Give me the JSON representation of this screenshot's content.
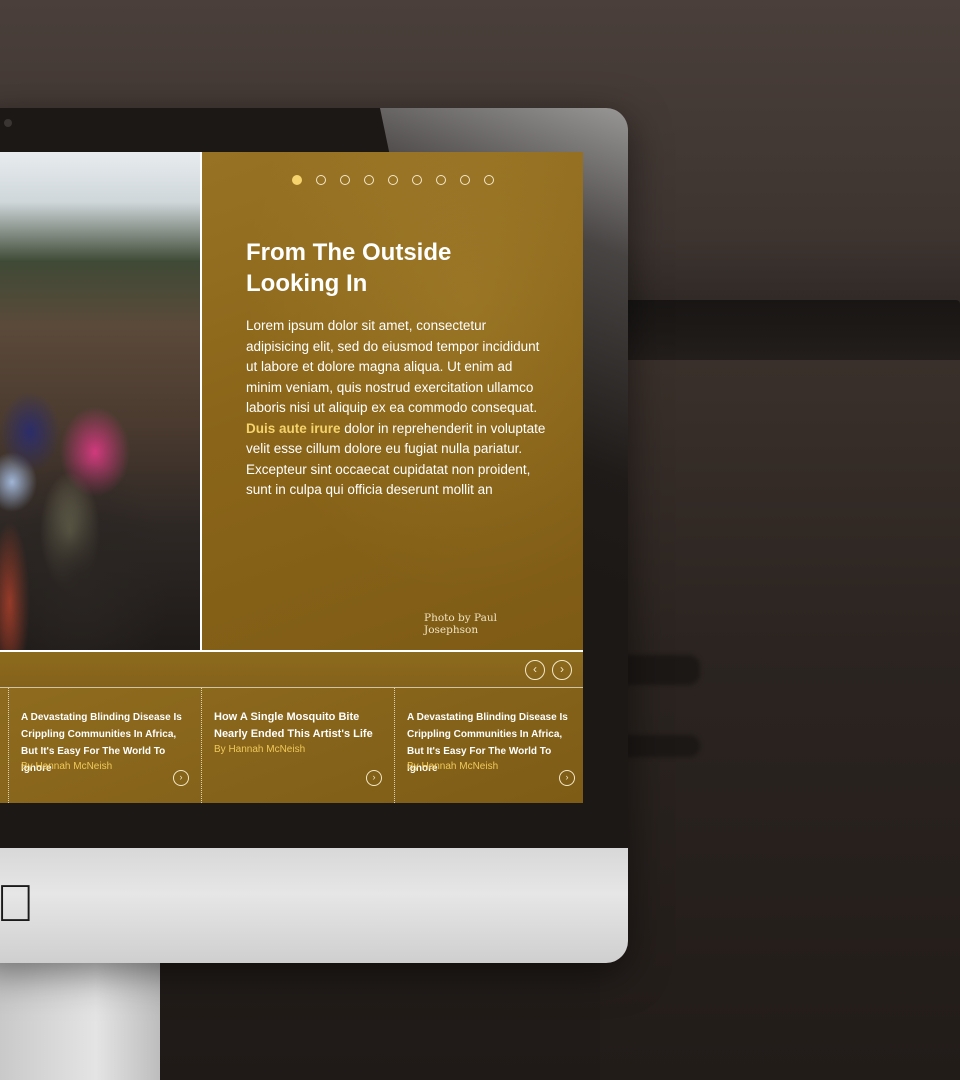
{
  "slider": {
    "dot_count": 9,
    "active_dot": 0,
    "title": "From The Outside Looking In",
    "body_before": "Lorem ipsum dolor sit amet, consectetur adipisicing elit, sed do eiusmod tempor incididunt ut labore et dolore magna aliqua. Ut enim ad minim veniam, quis nostrud exercitation ullamco laboris nisi ut aliquip ex ea commodo consequat. ",
    "body_highlight": "Duis aute irure",
    "body_after": " dolor in reprehenderit in voluptate velit esse cillum dolore eu fugiat nulla pariatur. Excepteur sint occaecat cupidatat non proident, sunt in culpa qui officia deserunt mollit an",
    "photo_credit": "Photo by Paul Josephson"
  },
  "navigation": {
    "prev_icon": "chevron-left-icon",
    "next_icon": "chevron-right-icon"
  },
  "cards": [
    {
      "title": "A Devastating Blinding Disease Is Crippling Communities In Africa, But It's Easy For The World To Ignore",
      "author": "By Hannah McNeish"
    },
    {
      "title": "How A Single Mosquito Bite Nearly Ended This Artist's Life",
      "author": "By Hannah McNeish"
    },
    {
      "title": "A Devastating Blinding Disease Is Crippling Communities In Africa, But It's Easy For The World To Ignore",
      "author": "By Hannah McNeish"
    }
  ],
  "colors": {
    "panel_gold": "#8d6a1e",
    "accent_yellow": "#f6d36c",
    "author_gold": "#f0c95a"
  },
  "icons": {
    "card_arrow": "chevron-right-icon",
    "device_logo": "apple-logo"
  }
}
